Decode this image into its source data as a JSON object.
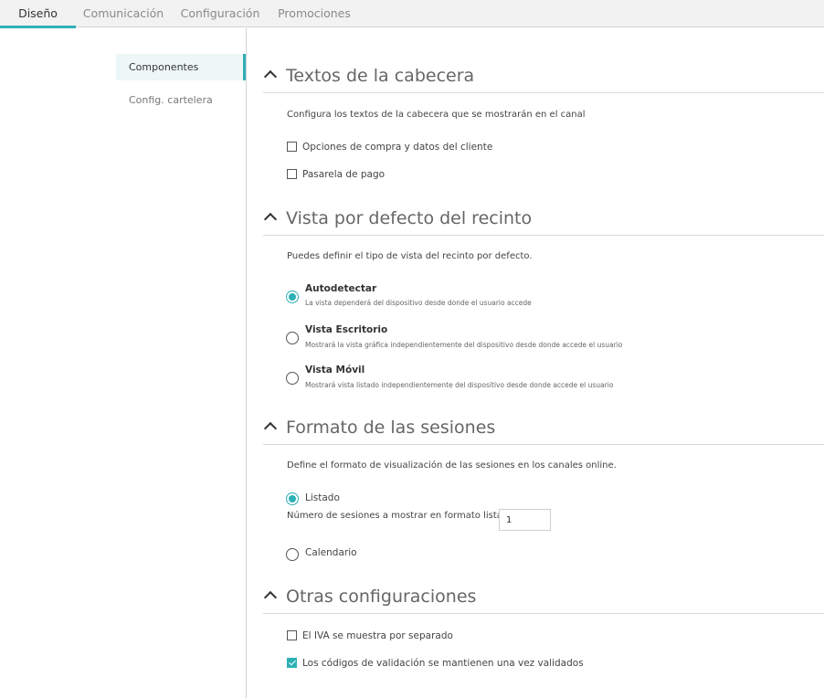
{
  "tabs": [
    {
      "label": "Diseño",
      "active": true
    },
    {
      "label": "Comunicación",
      "active": false
    },
    {
      "label": "Configuración",
      "active": false
    },
    {
      "label": "Promociones",
      "active": false
    }
  ],
  "sidebar": {
    "items": [
      {
        "label": "Componentes",
        "active": true
      },
      {
        "label": "Config. cartelera",
        "active": false
      }
    ]
  },
  "sections": {
    "header_texts": {
      "title": "Textos de la cabecera",
      "description": "Configura los textos de la cabecera que se mostrarán en el canal",
      "options": [
        {
          "label": "Opciones de compra y datos del cliente",
          "checked": false
        },
        {
          "label": "Pasarela de pago",
          "checked": false
        }
      ]
    },
    "venue_view": {
      "title": "Vista por defecto del recinto",
      "description": "Puedes definir el tipo de vista del recinto por defecto.",
      "options": [
        {
          "label": "Autodetectar",
          "sublabel": "La vista dependerá del dispositivo desde donde el usuario accede",
          "selected": true
        },
        {
          "label": "Vista Escritorio",
          "sublabel": "Mostrará la vista gráfica independientemente del dispositivo desde donde accede el usuario",
          "selected": false
        },
        {
          "label": "Vista Móvil",
          "sublabel": "Mostrará vista listado independientemente del dispositivo desde donde accede el usuario",
          "selected": false
        }
      ]
    },
    "session_format": {
      "title": "Formato de las sesiones",
      "description": "Define el formato de visualización de las sesiones en los canales online.",
      "options": [
        {
          "label": "Listado",
          "selected": true
        },
        {
          "label": "Calendario",
          "selected": false
        }
      ],
      "sessions_count_label": "Número de sesiones a mostrar en formato listado",
      "sessions_count_value": "1"
    },
    "other": {
      "title": "Otras configuraciones",
      "options": [
        {
          "label": "El IVA se muestra por separado",
          "checked": false
        },
        {
          "label": "Los códigos de validación se mantienen una vez validados",
          "checked": true
        }
      ]
    }
  },
  "colors": {
    "accent": "#2db0b5",
    "tabbar_bg": "#f2f2f2",
    "nav_active_bg": "#eef7f7"
  },
  "icons": {
    "section_toggle": "chevron-up-icon"
  }
}
